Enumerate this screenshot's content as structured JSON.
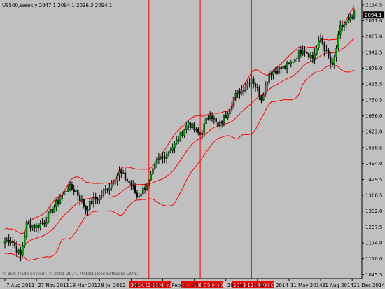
{
  "window": {
    "title": "US500,Weekly  2047.1 2094.1 2036.3 2094.1",
    "copyright": "© BCS Trade System. © 2001-2014, MetaQuotes Software Corp."
  },
  "colors": {
    "background": "#c0c0c0",
    "bull": "#00a000",
    "bear": "#000000",
    "wick": "#000000",
    "bands": "#ff0000",
    "vlines": "#ff0000",
    "last_price_bg": "#000000",
    "vline_label_bg": "#ff0000"
  },
  "chart_data": {
    "type": "candlestick",
    "symbol": "US500",
    "timeframe": "Weekly",
    "ohlc_header": {
      "open": 2047.1,
      "high": 2094.1,
      "low": 2036.3,
      "close": 2094.1
    },
    "last_price": "2094.1",
    "ylim": [
      1030,
      2140
    ],
    "y_ticks": [
      "2134.5",
      "2071.0",
      "2007.0",
      "1942.5",
      "1879.0",
      "1815.5",
      "1750.5",
      "1686.0",
      "1623.0",
      "1558.5",
      "1494.0",
      "1429.5",
      "1366.5",
      "1302.0",
      "1237.5",
      "1174.0",
      "1110.0",
      "1045.5"
    ],
    "x_ticks": [
      "7 Aug 2011",
      "27 Nov 2011",
      "18 Mar 2012",
      "8 Jul 2012",
      "28 Oct 2012",
      "17 Feb 2013",
      "9 Jun 2013",
      "29 Sep 2013",
      "19 Jan 2014",
      "11 May 2014",
      "31 Aug 2014",
      "21 Dec 2014"
    ],
    "x_range": [
      "7 Aug 2011",
      "28 Dec 2014"
    ],
    "period_markers": [
      {
        "label": "2012.12.30 00:00",
        "date": "30 Dec 2012"
      },
      {
        "label": "2013.06.30 00:00",
        "date": "30 Jun 2013"
      },
      {
        "label": "2013.12.29 00:00",
        "date": "29 Dec 2013"
      }
    ],
    "close_path_weekly_approx": {
      "points": [
        [
          "7 Aug 2011",
          1180
        ],
        [
          "28 Aug 2011",
          1190
        ],
        [
          "2 Oct 2011",
          1120
        ],
        [
          "23 Oct 2011",
          1250
        ],
        [
          "27 Nov 2011",
          1240
        ],
        [
          "25 Dec 2011",
          1260
        ],
        [
          "29 Jan 2012",
          1320
        ],
        [
          "26 Feb 2012",
          1365
        ],
        [
          "18 Mar 2012",
          1400
        ],
        [
          "15 Apr 2012",
          1385
        ],
        [
          "20 May 2012",
          1310
        ],
        [
          "10 Jun 2012",
          1340
        ],
        [
          "8 Jul 2012",
          1360
        ],
        [
          "12 Aug 2012",
          1405
        ],
        [
          "16 Sep 2012",
          1460
        ],
        [
          "28 Oct 2012",
          1410
        ],
        [
          "18 Nov 2012",
          1360
        ],
        [
          "30 Dec 2012",
          1420
        ],
        [
          "27 Jan 2013",
          1500
        ],
        [
          "17 Feb 2013",
          1520
        ],
        [
          "31 Mar 2013",
          1570
        ],
        [
          "19 May 2013",
          1660
        ],
        [
          "9 Jun 2013",
          1630
        ],
        [
          "30 Jun 2013",
          1610
        ],
        [
          "4 Aug 2013",
          1700
        ],
        [
          "1 Sep 2013",
          1640
        ],
        [
          "29 Sep 2013",
          1690
        ],
        [
          "27 Oct 2013",
          1760
        ],
        [
          "1 Dec 2013",
          1800
        ],
        [
          "29 Dec 2013",
          1840
        ],
        [
          "2 Feb 2014",
          1760
        ],
        [
          "2 Mar 2014",
          1860
        ],
        [
          "11 May 2014",
          1890
        ],
        [
          "29 Jun 2014",
          1960
        ],
        [
          "3 Aug 2014",
          1920
        ],
        [
          "31 Aug 2014",
          2000
        ],
        [
          "12 Oct 2014",
          1880
        ],
        [
          "9 Nov 2014",
          2040
        ],
        [
          "21 Dec 2014",
          2080
        ],
        [
          "28 Dec 2014",
          2094
        ]
      ]
    },
    "bollinger_bands": {
      "period_note": "",
      "width_points": 150
    }
  }
}
